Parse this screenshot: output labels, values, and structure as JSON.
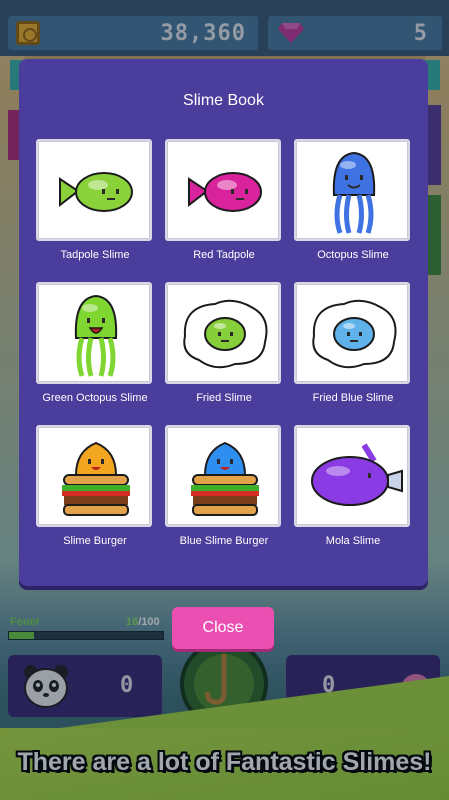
{
  "hud": {
    "coins": "38,360",
    "gems": "5"
  },
  "progress": {
    "label": "Feuer",
    "current": "16",
    "max": "/100",
    "fraction": 0.16
  },
  "bottom_panels": {
    "left_count": "0",
    "right_count": "0"
  },
  "modal": {
    "title": "Slime Book",
    "close_label": "Close",
    "slimes": [
      {
        "name": "Tadpole Slime",
        "icon": "tadpole-slime-icon",
        "color": "#8bd23a"
      },
      {
        "name": "Red Tadpole",
        "icon": "red-tadpole-icon",
        "color": "#d9239c"
      },
      {
        "name": "Octopus Slime",
        "icon": "octopus-slime-icon",
        "color": "#3f73e4"
      },
      {
        "name": "Green Octopus Slime",
        "icon": "green-octopus-slime-icon",
        "color": "#7fd631"
      },
      {
        "name": "Fried Slime",
        "icon": "fried-slime-icon",
        "color": "#86cf3a"
      },
      {
        "name": "Fried Blue Slime",
        "icon": "fried-blue-slime-icon",
        "color": "#5fb3ea"
      },
      {
        "name": "Slime Burger",
        "icon": "slime-burger-icon",
        "color": "#f2a51f"
      },
      {
        "name": "Blue Slime Burger",
        "icon": "blue-slime-burger-icon",
        "color": "#2f8ff0"
      },
      {
        "name": "Mola Slime",
        "icon": "mola-slime-icon",
        "color": "#8b3be3"
      }
    ]
  },
  "banner": {
    "text": "There are a lot of Fantastic Slimes!"
  }
}
